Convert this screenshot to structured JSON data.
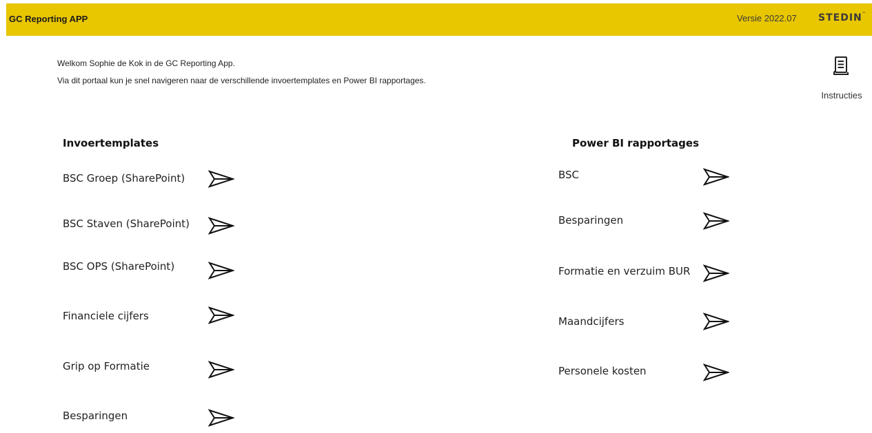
{
  "header": {
    "title": "GC Reporting APP",
    "version": "Versie 2022.07",
    "logo_text": "STEDIN",
    "logo_mark": "™",
    "bar_color": "#e8c600"
  },
  "intro": {
    "welcome": "Welkom Sophie de Kok in de GC Reporting App.",
    "description": "Via dit portaal kun je snel navigeren naar de verschillende invoertemplates en Power BI rapportages."
  },
  "instructions": {
    "label": "Instructies",
    "icon": "document-icon"
  },
  "invoertemplates": {
    "title": "Invoertemplates",
    "items": [
      {
        "label": "BSC Groep (SharePoint)",
        "icon": "send-arrow-icon"
      },
      {
        "label": "BSC Staven (SharePoint)",
        "icon": "send-arrow-icon"
      },
      {
        "label": "BSC OPS (SharePoint)",
        "icon": "send-arrow-icon"
      },
      {
        "label": "Financiele cijfers",
        "icon": "send-arrow-icon"
      },
      {
        "label": "Grip op Formatie",
        "icon": "send-arrow-icon"
      },
      {
        "label": "Besparingen",
        "icon": "send-arrow-icon"
      }
    ]
  },
  "powerbi": {
    "title": "Power BI rapportages",
    "items": [
      {
        "label": "BSC",
        "icon": "send-arrow-icon"
      },
      {
        "label": "Besparingen",
        "icon": "send-arrow-icon"
      },
      {
        "label": "Formatie en verzuim BUR",
        "icon": "send-arrow-icon"
      },
      {
        "label": "Maandcijfers",
        "icon": "send-arrow-icon"
      },
      {
        "label": "Personele kosten",
        "icon": "send-arrow-icon"
      }
    ]
  }
}
